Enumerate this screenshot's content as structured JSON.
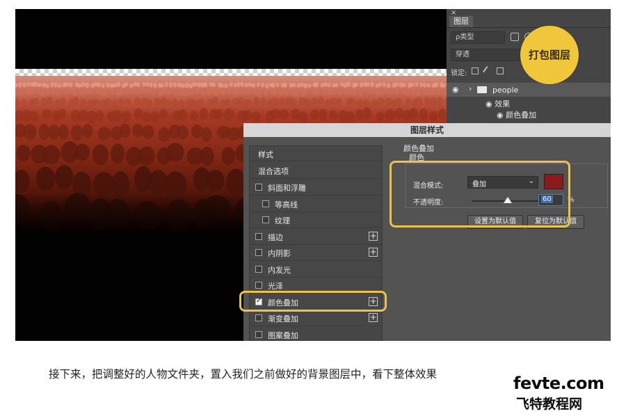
{
  "layers_panel": {
    "close_glyph": "×",
    "tab_label": "图层",
    "kind_filter": "ρ类型",
    "blend_mode": "穿透",
    "lock_label": "锁定:",
    "layer_name": "people",
    "effects_label": "效果",
    "effect_item": "颜色叠加"
  },
  "badge": {
    "text": "打包图层",
    "color": "#f0c63a"
  },
  "dialog": {
    "title": "图层样式",
    "styles_header": "样式",
    "blend_options": "混合选项",
    "items": [
      {
        "label": "斜面和浮雕",
        "checked": false,
        "plus": false
      },
      {
        "label": "等高线",
        "checked": false,
        "plus": false
      },
      {
        "label": "纹理",
        "checked": false,
        "plus": false
      },
      {
        "label": "描边",
        "checked": false,
        "plus": true
      },
      {
        "label": "内阴影",
        "checked": false,
        "plus": true
      },
      {
        "label": "内发光",
        "checked": false,
        "plus": false
      },
      {
        "label": "光泽",
        "checked": false,
        "plus": false
      },
      {
        "label": "颜色叠加",
        "checked": true,
        "plus": true
      },
      {
        "label": "渐变叠加",
        "checked": false,
        "plus": true
      },
      {
        "label": "图案叠加",
        "checked": false,
        "plus": false
      }
    ],
    "overlay": {
      "section_title": "颜色叠加",
      "sub_title": "颜色",
      "blend_label": "混合模式:",
      "blend_value": "叠加",
      "overlay_color": "#8b1a1d",
      "opacity_label": "不透明度:",
      "opacity_value": "60",
      "opacity_unit": "%",
      "make_default": "设置为默认值",
      "reset_default": "复位为默认值"
    }
  },
  "highlight_color": "#e9c446",
  "caption": "接下来，把调整好的人物文件夹，置入我们之前做好的背景图层中，看下整体效果",
  "watermark": {
    "url": "fevte.com",
    "name": "飞特教程网"
  }
}
